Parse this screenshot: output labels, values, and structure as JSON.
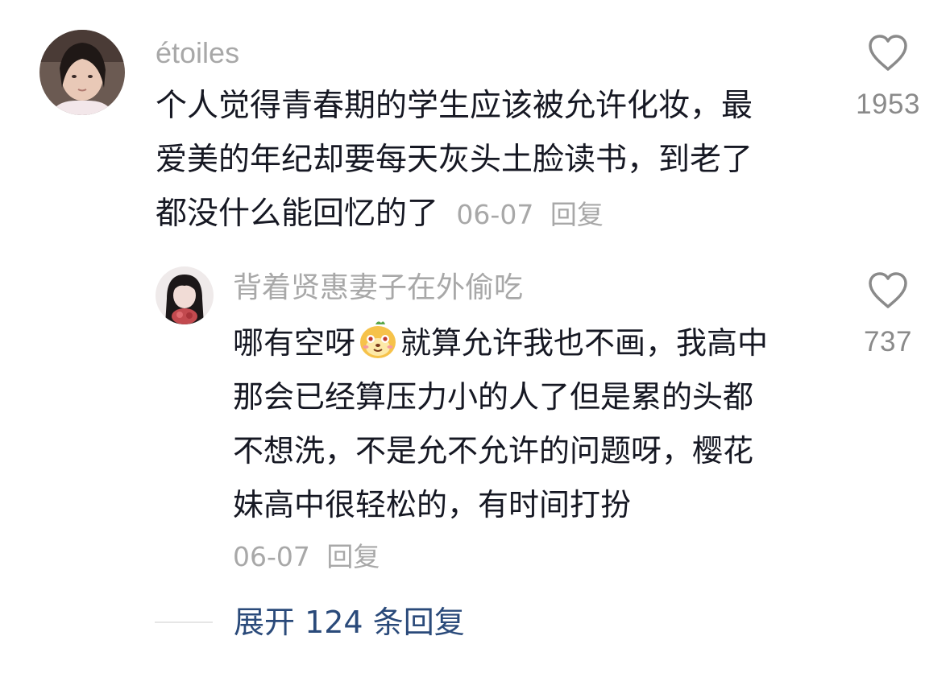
{
  "comment": {
    "username": "étoiles",
    "text_lines": [
      "个人觉得青春期的学生应该被允许化妆，最",
      "爱美的年纪却要每天灰头土脸读书，到老了",
      "都没什么能回忆的了"
    ],
    "date": "06-07",
    "reply_label": "回复",
    "like_count": "1953"
  },
  "reply": {
    "username": "背着贤惠妻子在外偷吃",
    "text_line1_before_emoji": "哪有空呀",
    "emoji_name": "smug-face-emoji",
    "text_line1_after_emoji": "就算允许我也不画，我高中",
    "text_lines": [
      "那会已经算压力小的人了但是累的头都",
      "不想洗，不是允不允许的问题呀，樱花",
      "妹高中很轻松的，有时间打扮"
    ],
    "date": "06-07",
    "reply_label": "回复",
    "like_count": "737"
  },
  "expand": {
    "label": "展开 124 条回复"
  },
  "colors": {
    "text": "#161823",
    "meta": "#a8a8a8",
    "link": "#2a4a7a"
  }
}
